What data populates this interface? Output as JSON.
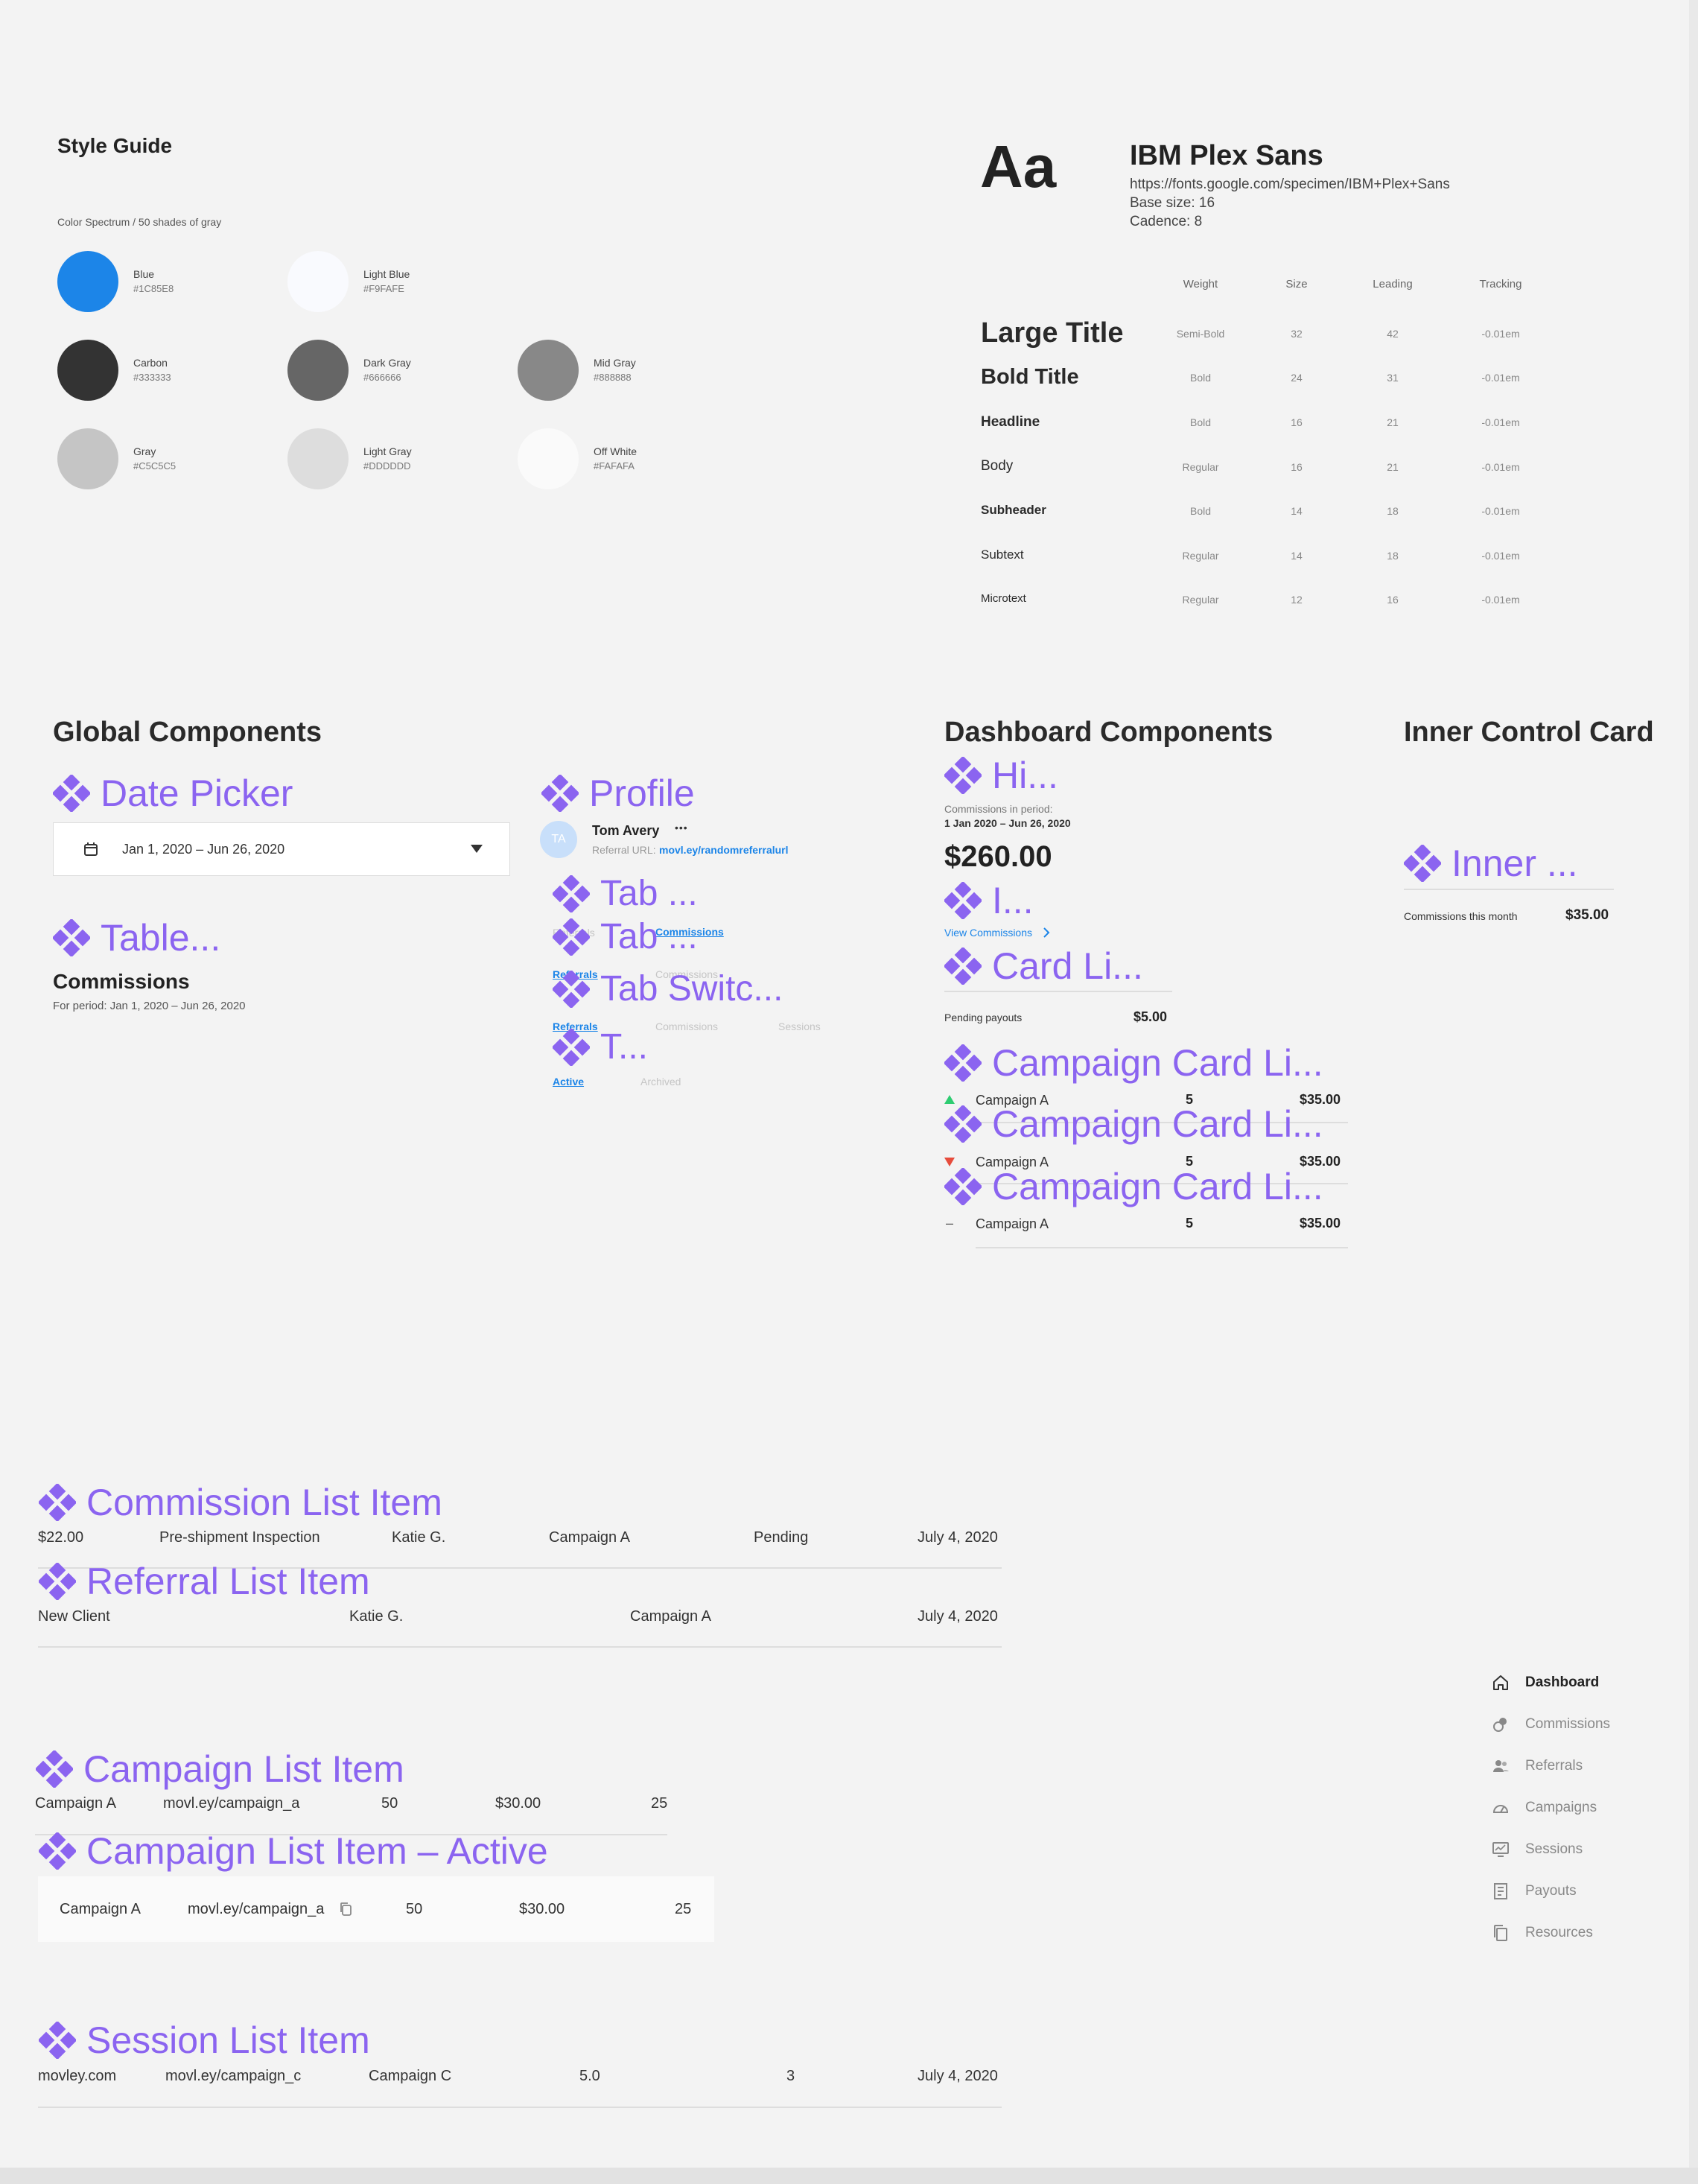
{
  "style_guide": {
    "title": "Style Guide",
    "spectrum_label": "Color Spectrum / 50 shades of gray",
    "swatches": [
      {
        "name": "Blue",
        "hex": "#1C85E8",
        "color": "#1c85e8"
      },
      {
        "name": "Light Blue",
        "hex": "#F9FAFE",
        "color": "#f9fafe"
      },
      {
        "name": "Carbon",
        "hex": "#333333",
        "color": "#333333"
      },
      {
        "name": "Dark Gray",
        "hex": "#666666",
        "color": "#666666"
      },
      {
        "name": "Mid Gray",
        "hex": "#888888",
        "color": "#888888"
      },
      {
        "name": "Gray",
        "hex": "#C5C5C5",
        "color": "#c5c5c5"
      },
      {
        "name": "Light Gray",
        "hex": "#DDDDDD",
        "color": "#dddddd"
      },
      {
        "name": "Off White",
        "hex": "#FAFAFA",
        "color": "#fafafa"
      }
    ]
  },
  "typography": {
    "sample": "Aa",
    "font_name": "IBM Plex Sans",
    "url": "https://fonts.google.com/specimen/IBM+Plex+Sans",
    "base_size": "Base size: 16",
    "cadence": "Cadence: 8",
    "headers": [
      "Weight",
      "Size",
      "Leading",
      "Tracking"
    ],
    "rows": [
      {
        "label": "Large Title",
        "weight": "Semi-Bold",
        "size": "32",
        "leading": "42",
        "tracking": "-0.01em"
      },
      {
        "label": "Bold Title",
        "weight": "Bold",
        "size": "24",
        "leading": "31",
        "tracking": "-0.01em"
      },
      {
        "label": "Headline",
        "weight": "Bold",
        "size": "16",
        "leading": "21",
        "tracking": "-0.01em"
      },
      {
        "label": "Body",
        "weight": "Regular",
        "size": "16",
        "leading": "21",
        "tracking": "-0.01em"
      },
      {
        "label": "Subheader",
        "weight": "Bold",
        "size": "14",
        "leading": "18",
        "tracking": "-0.01em"
      },
      {
        "label": "Subtext",
        "weight": "Regular",
        "size": "14",
        "leading": "18",
        "tracking": "-0.01em"
      },
      {
        "label": "Microtext",
        "weight": "Regular",
        "size": "12",
        "leading": "16",
        "tracking": "-0.01em"
      }
    ]
  },
  "global": {
    "title": "Global Components",
    "date_picker_title": "Date Picker",
    "date_range": "Jan 1, 2020 – Jun 26, 2020",
    "table_title": "Table...",
    "table_heading": "Commissions",
    "table_period": "For period: Jan 1, 2020 – Jun 26, 2020",
    "profile_title": "Profile",
    "profile_initials": "TA",
    "profile_name": "Tom Avery",
    "profile_more": "•••",
    "profile_referral_label": "Referral URL:",
    "profile_referral_url": "movl.ey/randomreferralurl",
    "tab_titles": [
      "Tab ...",
      "Tab ...",
      "Tab Switc...",
      "T..."
    ],
    "tabs_a": [
      "Referrals",
      "Commissions"
    ],
    "tabs_b": [
      "Referrals",
      "Commissions"
    ],
    "tabs_c": [
      "Referrals",
      "Commissions",
      "Sessions"
    ],
    "tabs_d": [
      "Active",
      "Archived"
    ]
  },
  "dashboard": {
    "title": "Dashboard Components",
    "hi_title": "Hi...",
    "commissions_in_period": "Commissions in period:",
    "period": "1 Jan 2020 – Jun 26, 2020",
    "amount": "$260.00",
    "i_title": "I...",
    "view_commissions": "View Commissions",
    "card_title": "Card Li...",
    "pending_label": "Pending payouts",
    "pending_value": "$5.00",
    "campaign_card_title": "Campaign Card Li...",
    "campaign_rows": [
      {
        "name": "Campaign A",
        "count": "5",
        "amount": "$35.00",
        "trend": "up"
      },
      {
        "name": "Campaign A",
        "count": "5",
        "amount": "$35.00",
        "trend": "down"
      },
      {
        "name": "Campaign A",
        "count": "5",
        "amount": "$35.00",
        "trend": "flat"
      }
    ],
    "flat_symbol": "–"
  },
  "inner": {
    "title": "Inner Control Card",
    "comp_title": "Inner ...",
    "label": "Commissions this month",
    "value": "$35.00"
  },
  "lists": {
    "commission_title": "Commission List Item",
    "commission": [
      "$22.00",
      "Pre-shipment Inspection",
      "Katie G.",
      "Campaign A",
      "Pending",
      "July 4, 2020"
    ],
    "referral_title": "Referral List Item",
    "referral": [
      "New Client",
      "Katie G.",
      "Campaign A",
      "July 4, 2020"
    ],
    "campaign_title": "Campaign List Item",
    "campaign": [
      "Campaign A",
      "movl.ey/campaign_a",
      "50",
      "$30.00",
      "25"
    ],
    "campaign_active_title": "Campaign List Item – Active",
    "campaign_active": [
      "Campaign A",
      "movl.ey/campaign_a",
      "50",
      "$30.00",
      "25"
    ],
    "session_title": "Session List Item",
    "session": [
      "movley.com",
      "movl.ey/campaign_c",
      "Campaign C",
      "5.0",
      "3",
      "July 4, 2020"
    ]
  },
  "nav": [
    {
      "label": "Dashboard",
      "icon": "home-icon",
      "active": true
    },
    {
      "label": "Commissions",
      "icon": "coins-icon",
      "active": false
    },
    {
      "label": "Referrals",
      "icon": "users-icon",
      "active": false
    },
    {
      "label": "Campaigns",
      "icon": "gauge-icon",
      "active": false
    },
    {
      "label": "Sessions",
      "icon": "monitor-icon",
      "active": false
    },
    {
      "label": "Payouts",
      "icon": "receipt-icon",
      "active": false
    },
    {
      "label": "Resources",
      "icon": "copy-icon",
      "active": false
    }
  ],
  "colors": {
    "accent": "#8b64f0",
    "blue": "#1c85e8",
    "up": "#2ecc71",
    "down": "#e74c3c"
  }
}
